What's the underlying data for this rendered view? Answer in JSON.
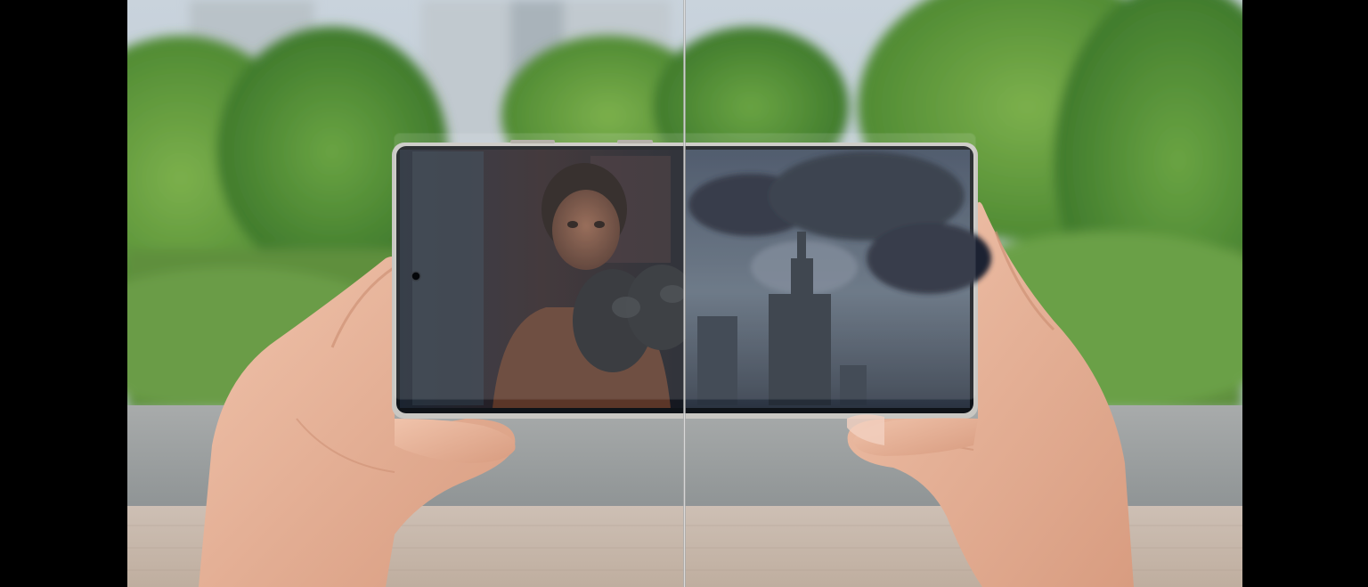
{
  "image": {
    "description_colors": {
      "letterbox": "#000000",
      "sky": "#c9d3dc",
      "foliage": "#5f9a3e",
      "wall": "#9fa4a6",
      "pavement": "#c8b9ad",
      "skin": "#e7b39a",
      "phone_frame": "#c9c7c2"
    },
    "icons": [
      "front-camera-icon"
    ]
  }
}
